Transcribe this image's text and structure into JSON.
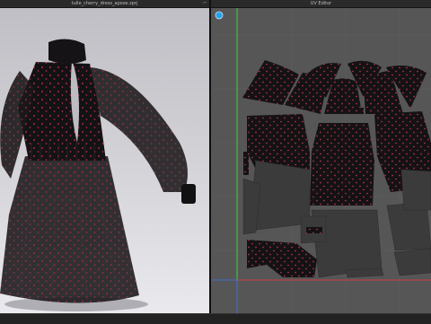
{
  "viewport": {
    "file_title": "tulle_cherry_dress_apose.zprj"
  },
  "uv_editor": {
    "title": "UV Editor"
  },
  "colors": {
    "fabric": "#151214",
    "print_dot": "#b0304a",
    "uv_bg": "#565656",
    "grid_line": "#6a6a6a",
    "axis_green": "#3fcf3f",
    "axis_red": "#cf3f3f",
    "axis_blue": "#3f6fcf"
  },
  "icons": [
    "pin-icon",
    "gizmo-icon"
  ]
}
